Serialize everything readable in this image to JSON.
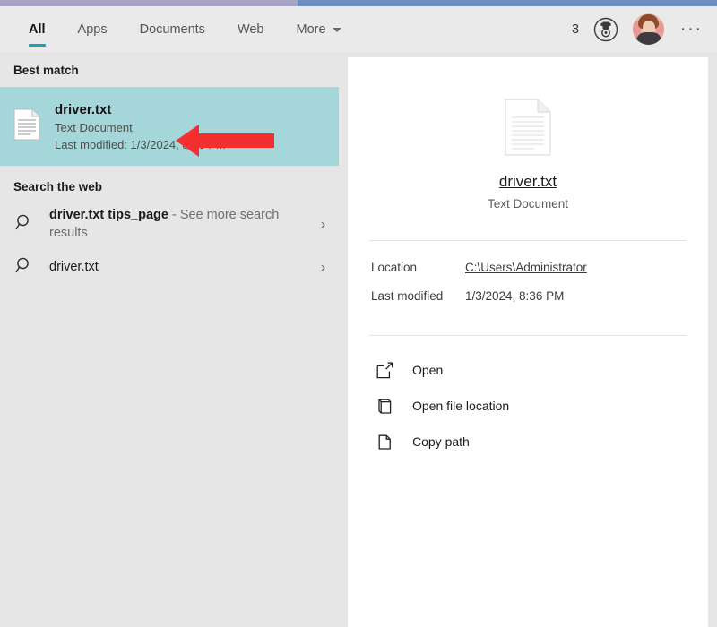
{
  "header": {
    "tabs": [
      {
        "label": "All",
        "active": true
      },
      {
        "label": "Apps",
        "active": false
      },
      {
        "label": "Documents",
        "active": false
      },
      {
        "label": "Web",
        "active": false
      },
      {
        "label": "More",
        "active": false,
        "caret": true
      }
    ],
    "reward_count": "3",
    "badge_icon": "award-medal-icon",
    "avatar_icon": "user-avatar",
    "overflow_label": "···",
    "accent_color": "#18a5b2"
  },
  "left": {
    "best_match_heading": "Best match",
    "best_match": {
      "icon": "text-document-icon",
      "title": "driver.txt",
      "subtitle": "Text Document",
      "meta": "Last modified: 1/3/2024, 8:36 PM",
      "highlight_color": "#a5d7da"
    },
    "annotation": {
      "type": "arrow-left",
      "color": "#f42f2f"
    },
    "web_heading": "Search the web",
    "web_results": [
      {
        "icon": "search-icon",
        "query": "driver.txt tips_page",
        "suffix": " - See more search results",
        "chevron": "›"
      },
      {
        "icon": "search-icon",
        "query": "driver.txt",
        "suffix": "",
        "chevron": "›"
      }
    ]
  },
  "preview": {
    "icon": "text-document-icon-large",
    "filename": "driver.txt",
    "filetype": "Text Document",
    "meta": [
      {
        "label": "Location",
        "value": "C:\\Users\\Administrator",
        "is_link": true
      },
      {
        "label": "Last modified",
        "value": "1/3/2024, 8:36 PM",
        "is_link": false
      }
    ],
    "actions": [
      {
        "icon": "open-external-icon",
        "label": "Open"
      },
      {
        "icon": "folder-open-icon",
        "label": "Open file location"
      },
      {
        "icon": "copy-icon",
        "label": "Copy path"
      }
    ]
  }
}
